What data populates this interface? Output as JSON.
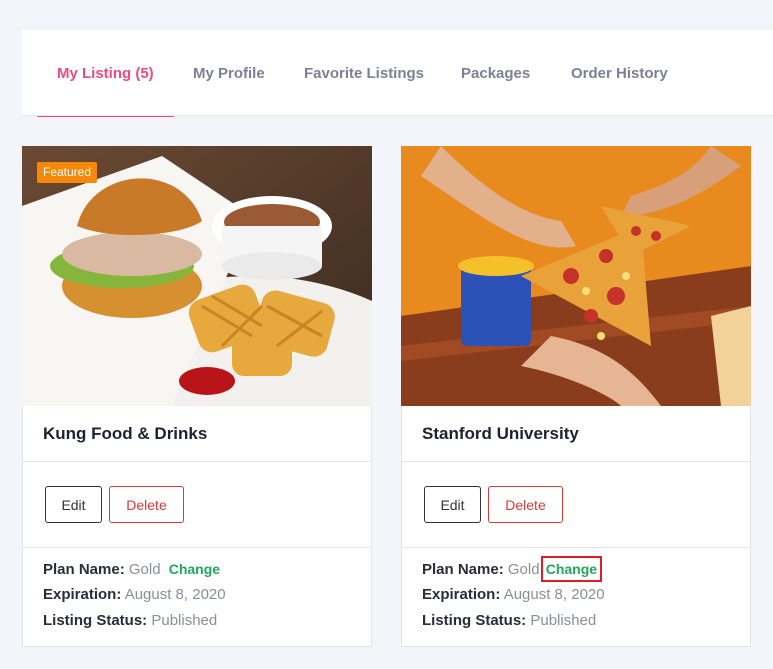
{
  "tabs": [
    {
      "label": "My Listing (5)",
      "active": true
    },
    {
      "label": "My Profile",
      "active": false
    },
    {
      "label": "Favorite Listings",
      "active": false
    },
    {
      "label": "Packages",
      "active": false
    },
    {
      "label": "Order History",
      "active": false
    }
  ],
  "listings": [
    {
      "title": "Kung Food & Drinks",
      "badge": "Featured",
      "image": "burger-fries-soup-photo",
      "edit_label": "Edit",
      "delete_label": "Delete",
      "plan_label": "Plan Name:",
      "plan_value": "Gold",
      "change_label": "Change",
      "expiration_label": "Expiration:",
      "expiration_value": "August 8, 2020",
      "status_label": "Listing Status:",
      "status_value": "Published"
    },
    {
      "title": "Stanford University",
      "image": "pizza-slices-photo",
      "edit_label": "Edit",
      "delete_label": "Delete",
      "plan_label": "Plan Name:",
      "plan_value": "Gold",
      "change_label": "Change",
      "expiration_label": "Expiration:",
      "expiration_value": "August 8, 2020",
      "status_label": "Listing Status:",
      "status_value": "Published"
    }
  ],
  "colors": {
    "active_tab": "#ef4b7f",
    "tab_text": "#7d8093",
    "badge": "#f5870b",
    "change_link": "#21a85c",
    "delete": "#d83a3a",
    "highlight_box": "#e11d24"
  }
}
